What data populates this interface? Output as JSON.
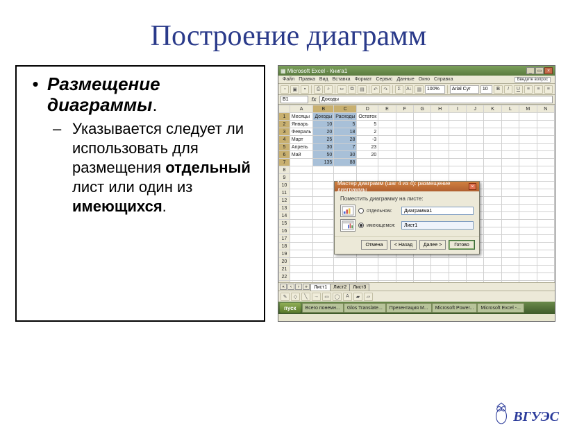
{
  "slide": {
    "title": "Построение диаграмм",
    "bullet1_bold": "Размещение диаграммы",
    "bullet1_tail": ".",
    "bullet2_pre": "Указывается следует ли использовать для размещения ",
    "bullet2_b1": "отдельный",
    "bullet2_mid": " лист или один из ",
    "bullet2_b2": "имеющихся",
    "bullet2_tail": "."
  },
  "footer": {
    "brand": "ВГУЭС"
  },
  "excel": {
    "title": "Microsoft Excel - Книга1",
    "help_hint": "Введите вопрос",
    "menu": [
      "Файл",
      "Правка",
      "Вид",
      "Вставка",
      "Формат",
      "Сервис",
      "Данные",
      "Окно",
      "Справка"
    ],
    "zoom": "100%",
    "font": "Arial Cyr",
    "fontsize": "10",
    "namebox": "B1",
    "formula": "Доходы",
    "cols": [
      "A",
      "B",
      "C",
      "D",
      "E",
      "F",
      "G",
      "H",
      "I",
      "J",
      "K",
      "L",
      "M",
      "N"
    ],
    "rows_count": 30,
    "data": {
      "B1": "Доходы",
      "C1": "Расходы",
      "D1": "Остаток",
      "A1": "Месяцы",
      "A2": "Январь",
      "A3": "Февраль",
      "A4": "Март",
      "A5": "Апрель",
      "A6": "Май",
      "A": "",
      "B2": "10",
      "B3": "20",
      "B4": "25",
      "B5": "30",
      "B6": "50",
      "B7": "135",
      "C2": "5",
      "C3": "18",
      "C4": "28",
      "C5": "7",
      "C6": "30",
      "C7": "88",
      "D2": "5",
      "D3": "2",
      "D4": "-3",
      "D5": "23",
      "D6": "20"
    },
    "selection": {
      "col_start": "B",
      "col_end": "C",
      "row_start": 1,
      "row_end": 7
    },
    "tabs": [
      "Лист1",
      "Лист2",
      "Лист3"
    ],
    "active_tab": 0
  },
  "dialog": {
    "title": "Мастер диаграмм (шаг 4 из 4): размещение диаграммы",
    "prompt": "Поместить диаграмму на листе:",
    "opt_separate_label": "отдельном:",
    "opt_separate_value": "Диаграмма1",
    "opt_existing_label": "имеющемся:",
    "opt_existing_value": "Лист1",
    "selected": "existing",
    "buttons": {
      "cancel": "Отмена",
      "back": "< Назад",
      "next": "Далее >",
      "finish": "Готово"
    }
  },
  "taskbar": {
    "start": "пуск",
    "items": [
      "Всего понемн...",
      "Glos Translate...",
      "Презентация M...",
      "Microsoft Power...",
      "Microsoft Excel -..."
    ]
  }
}
